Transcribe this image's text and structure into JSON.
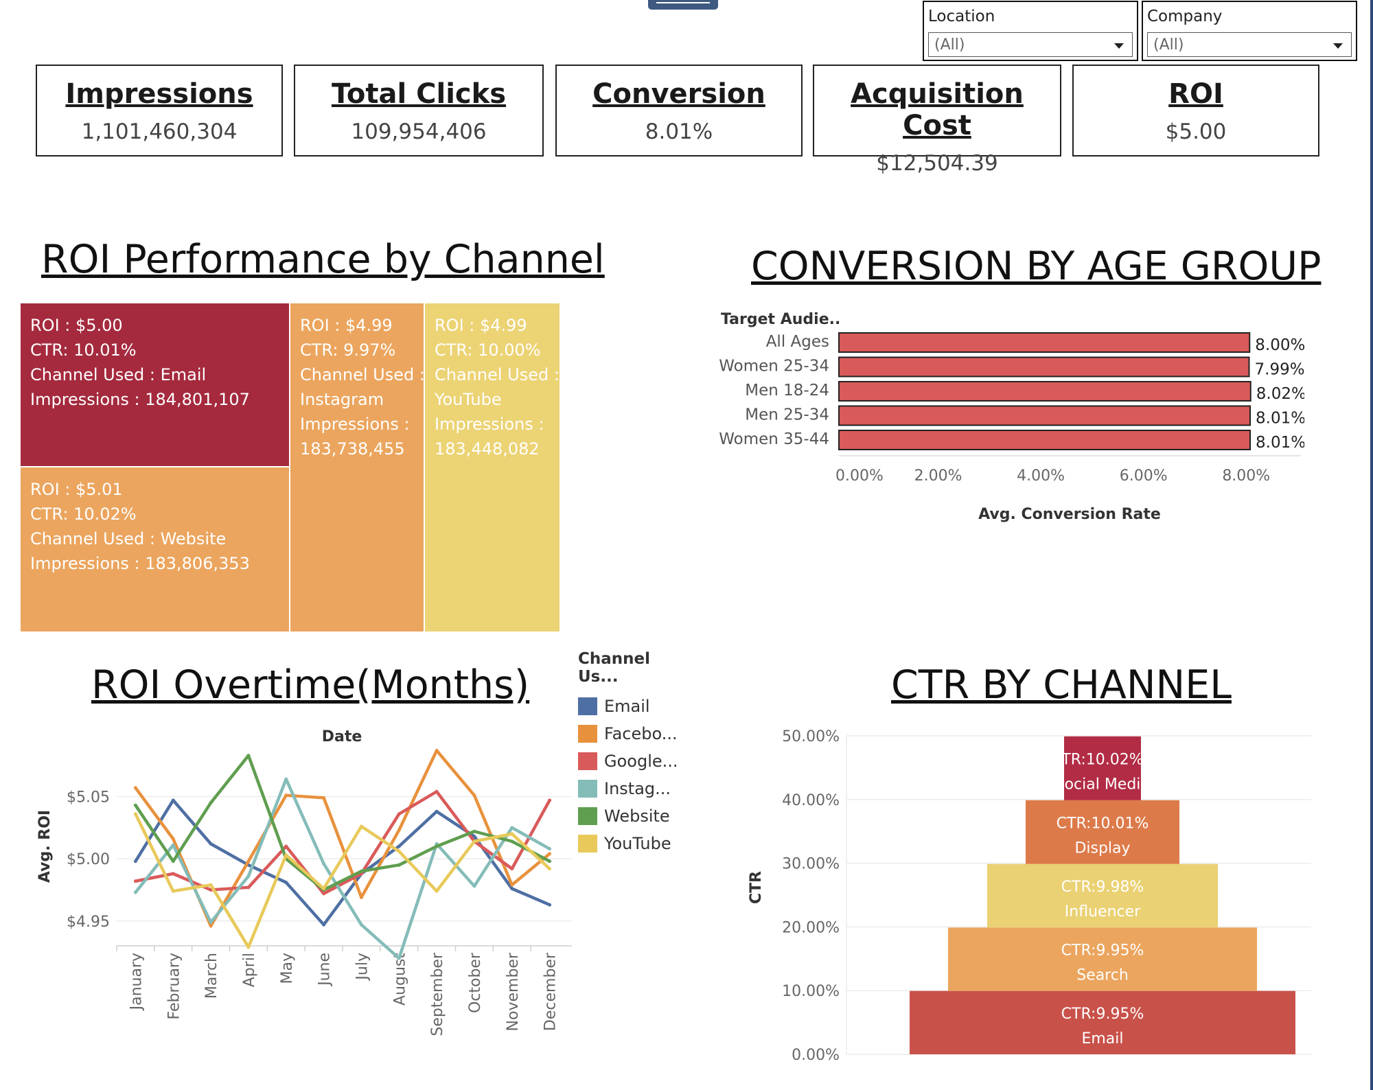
{
  "filters": [
    {
      "label": "Location",
      "value": "(All)"
    },
    {
      "label": "Company",
      "value": "(All)"
    }
  ],
  "kpis": [
    {
      "title": "Impressions",
      "value": "1,101,460,304"
    },
    {
      "title": "Total Clicks",
      "value": "109,954,406"
    },
    {
      "title": "Conversion",
      "value": "8.01%"
    },
    {
      "title": "Acquisition Cost",
      "value": "$12,504.39"
    },
    {
      "title": "ROI",
      "value": "$5.00"
    }
  ],
  "titles": {
    "roi_channel": "ROI Performance by Channel",
    "conv_age": "CONVERSION BY AGE GROUP",
    "roi_overtime": "ROI Overtime(Months)",
    "ctr_channel": "CTR BY CHANNEL"
  },
  "treemap": {
    "tiles": [
      {
        "lines": [
          "ROI : $5.00",
          "CTR: 10.01%",
          "Channel Used : Email",
          "Impressions : 184,801,107"
        ],
        "color": "#a52a3e"
      },
      {
        "lines": [
          "ROI : $5.01",
          "CTR: 10.02%",
          "Channel Used : Website",
          "Impressions : 183,806,353"
        ],
        "color": "#eba55e"
      },
      {
        "lines": [
          "ROI : $4.99",
          "CTR: 9.97%",
          "Channel Used :",
          "Instagram",
          "Impressions :",
          "183,738,455"
        ],
        "color": "#eba55e"
      },
      {
        "lines": [
          "ROI : $4.99",
          "CTR: 10.00%",
          "Channel Used :",
          "YouTube",
          "Impressions :",
          "183,448,082"
        ],
        "color": "#ecd374"
      }
    ]
  },
  "legend": {
    "title": "Channel Us...",
    "items": [
      {
        "label": "Email",
        "color": "#4e6fa3"
      },
      {
        "label": "Facebo...",
        "color": "#e8913d"
      },
      {
        "label": "Google...",
        "color": "#d95a5a"
      },
      {
        "label": "Instag...",
        "color": "#84bcb8"
      },
      {
        "label": "Website",
        "color": "#5f9e4f"
      },
      {
        "label": "YouTube",
        "color": "#e8c95a"
      }
    ]
  },
  "chart_data": [
    {
      "type": "bar",
      "orientation": "horizontal",
      "title": "CONVERSION BY AGE GROUP",
      "category_header": "Target Audie..",
      "xlabel": "Avg. Conversion Rate",
      "categories": [
        "All Ages",
        "Women 25-34",
        "Men 18-24",
        "Men 25-34",
        "Women 35-44"
      ],
      "values": [
        8.0,
        7.99,
        8.02,
        8.01,
        8.01
      ],
      "value_labels": [
        "8.00%",
        "7.99%",
        "8.02%",
        "8.01%",
        "8.01%"
      ],
      "xticks": [
        "0.00%",
        "2.00%",
        "4.00%",
        "6.00%",
        "8.00%"
      ],
      "xlim": [
        0,
        8.05
      ],
      "bar_color": "#d85a5a"
    },
    {
      "type": "line",
      "title": "ROI Overtime(Months)",
      "xlabel": "Date",
      "ylabel": "Avg. ROI",
      "categories": [
        "January",
        "February",
        "March",
        "April",
        "May",
        "June",
        "July",
        "August",
        "September",
        "October",
        "November",
        "December"
      ],
      "yticks": [
        "$4.95",
        "$5.00",
        "$5.05"
      ],
      "ylim": [
        4.93,
        5.09
      ],
      "series": [
        {
          "name": "Email",
          "color": "#4e6fa3",
          "values": [
            4.998,
            5.047,
            5.012,
            4.995,
            4.981,
            4.947,
            4.988,
            5.01,
            5.038,
            5.018,
            4.976,
            4.963
          ]
        },
        {
          "name": "Facebo...",
          "color": "#e8913d",
          "values": [
            5.057,
            5.016,
            4.946,
            4.998,
            5.051,
            5.049,
            4.969,
            5.023,
            5.087,
            5.051,
            4.979,
            5.004
          ]
        },
        {
          "name": "Google...",
          "color": "#d95a5a",
          "values": [
            4.982,
            4.988,
            4.975,
            4.977,
            5.01,
            4.972,
            4.988,
            5.036,
            5.054,
            5.014,
            4.992,
            5.047
          ]
        },
        {
          "name": "Instag...",
          "color": "#84bcb8",
          "values": [
            4.973,
            5.011,
            4.949,
            4.986,
            5.064,
            4.996,
            4.947,
            4.92,
            5.012,
            4.978,
            5.025,
            5.008
          ]
        },
        {
          "name": "Website",
          "color": "#5f9e4f",
          "values": [
            5.043,
            4.998,
            5.045,
            5.083,
            5.0,
            4.975,
            4.99,
            4.995,
            5.01,
            5.022,
            5.014,
            4.998
          ]
        },
        {
          "name": "YouTube",
          "color": "#e8c95a",
          "values": [
            5.036,
            4.974,
            4.979,
            4.929,
            5.003,
            4.976,
            5.026,
            5.006,
            4.974,
            5.014,
            5.02,
            4.992
          ]
        }
      ]
    },
    {
      "type": "bar",
      "subtype": "funnel",
      "title": "CTR BY CHANNEL",
      "ylabel": "CTR",
      "yticks": [
        "0.00%",
        "10.00%",
        "20.00%",
        "30.00%",
        "40.00%",
        "50.00%"
      ],
      "ylim": [
        0,
        50
      ],
      "levels": [
        {
          "channel": "Email",
          "ctr": 9.95,
          "label1": "CTR:9.95%",
          "label2": "Email",
          "color": "#c8524a"
        },
        {
          "channel": "Search",
          "ctr": 9.95,
          "label1": "CTR:9.95%",
          "label2": "Search",
          "color": "#eba55e"
        },
        {
          "channel": "Influencer",
          "ctr": 9.98,
          "label1": "CTR:9.98%",
          "label2": "Influencer",
          "color": "#ead173"
        },
        {
          "channel": "Display",
          "ctr": 10.01,
          "label1": "CTR:10.01%",
          "label2": "Display",
          "color": "#dd7a4a"
        },
        {
          "channel": "Social Media",
          "ctr": 10.02,
          "label1": "TR:10.02%",
          "label2": "ocial Medi",
          "color": "#b22c45"
        }
      ]
    }
  ]
}
